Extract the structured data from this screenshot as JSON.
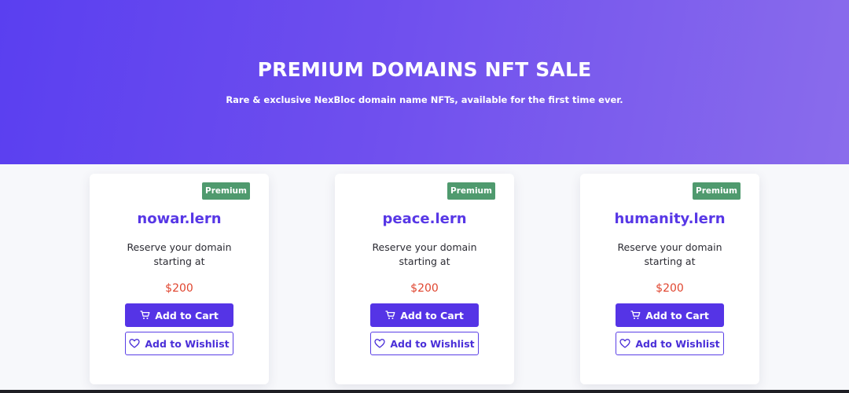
{
  "hero": {
    "title": "PREMIUM DOMAINS NFT SALE",
    "subtitle": "Rare & exclusive NexBloc domain name NFTs, available for the first time ever."
  },
  "colors": {
    "hero_gradient_start": "#5a3ff0",
    "hero_gradient_end": "#8a6cec",
    "domain_text": "#5737e6",
    "price_text": "#e0452f",
    "badge_bg": "#4f9a6e",
    "primary_button": "#5534e6"
  },
  "cards": [
    {
      "badge": "Premium",
      "domain": "nowar.lern",
      "desc_line1": "Reserve your domain",
      "desc_line2": "starting at",
      "price": "$200",
      "cart_label": "Add to Cart",
      "wishlist_label": "Add to Wishlist",
      "cart_icon": "cart-icon",
      "wishlist_icon": "heart-icon"
    },
    {
      "badge": "Premium",
      "domain": "peace.lern",
      "desc_line1": "Reserve your domain",
      "desc_line2": "starting at",
      "price": "$200",
      "cart_label": "Add to Cart",
      "wishlist_label": "Add to Wishlist",
      "cart_icon": "cart-icon",
      "wishlist_icon": "heart-icon"
    },
    {
      "badge": "Premium",
      "domain": "humanity.lern",
      "desc_line1": "Reserve your domain",
      "desc_line2": "starting at",
      "price": "$200",
      "cart_label": "Add to Cart",
      "wishlist_label": "Add to Wishlist",
      "cart_icon": "cart-icon",
      "wishlist_icon": "heart-icon"
    }
  ]
}
